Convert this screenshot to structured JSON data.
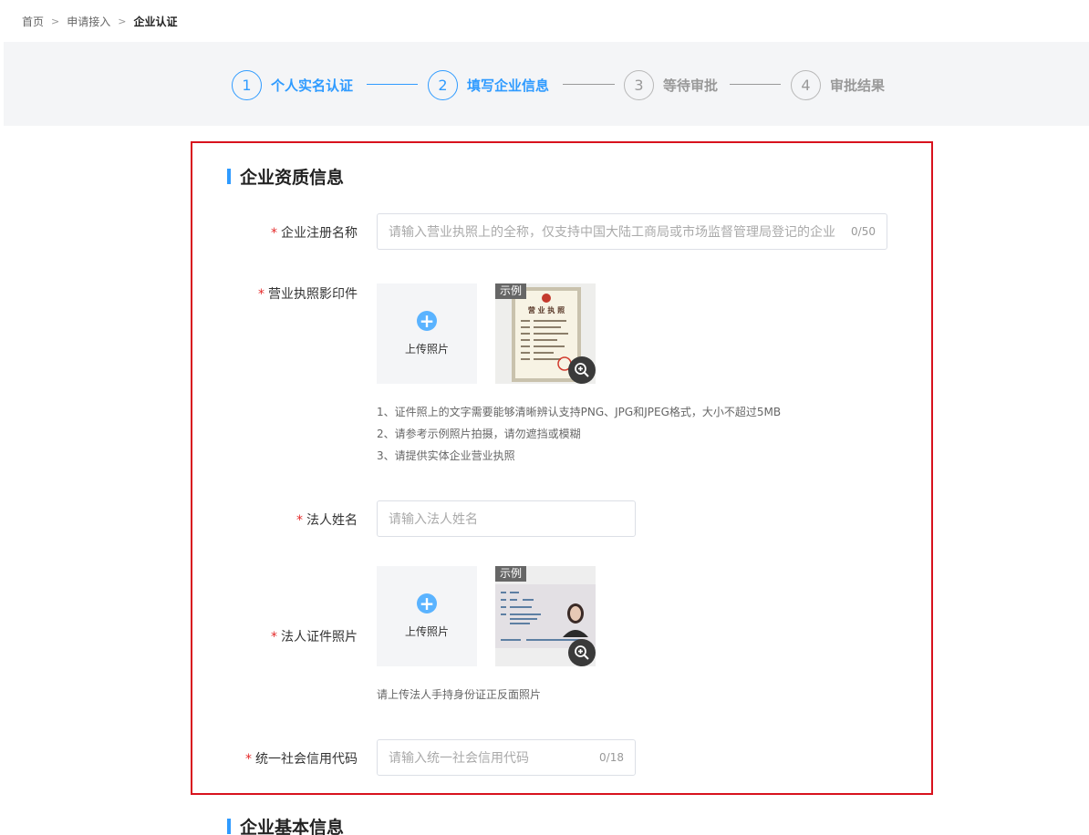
{
  "breadcrumb": {
    "home": "首页",
    "apply": "申请接入",
    "current": "企业认证",
    "sep": ">"
  },
  "steps": [
    {
      "num": "1",
      "label": "个人实名认证",
      "active": true
    },
    {
      "num": "2",
      "label": "填写企业信息",
      "active": true
    },
    {
      "num": "3",
      "label": "等待审批",
      "active": false
    },
    {
      "num": "4",
      "label": "审批结果",
      "active": false
    }
  ],
  "sections": {
    "qualification": "企业资质信息",
    "basic": "企业基本信息"
  },
  "form": {
    "required_mark": "*",
    "company_name": {
      "label": "企业注册名称",
      "placeholder": "请输入营业执照上的全称，仅支持中国大陆工商局或市场监督管理局登记的企业",
      "count": "0/50"
    },
    "license": {
      "label": "营业执照影印件",
      "upload": "上传照片",
      "sample_tag": "示例",
      "hints": [
        "1、证件照上的文字需要能够清晰辨认支持PNG、JPG和JPEG格式，大小不超过5MB",
        "2、请参考示例照片拍摄，请勿遮挡或模糊",
        "3、请提供实体企业营业执照"
      ]
    },
    "legal_name": {
      "label": "法人姓名",
      "placeholder": "请输入法人姓名"
    },
    "legal_id": {
      "label": "法人证件照片",
      "upload": "上传照片",
      "sample_tag": "示例",
      "hint": "请上传法人手持身份证正反面照片"
    },
    "credit_code": {
      "label": "统一社会信用代码",
      "placeholder": "请输入统一社会信用代码",
      "count": "0/18"
    }
  },
  "license_image_text": {
    "title": "营 业 执 照"
  },
  "icons": {
    "plus": "plus-icon",
    "zoom": "zoom-in-icon"
  },
  "colors": {
    "accent": "#2f9bff",
    "required": "#e52a2a",
    "highlight_border": "#d8121d"
  }
}
